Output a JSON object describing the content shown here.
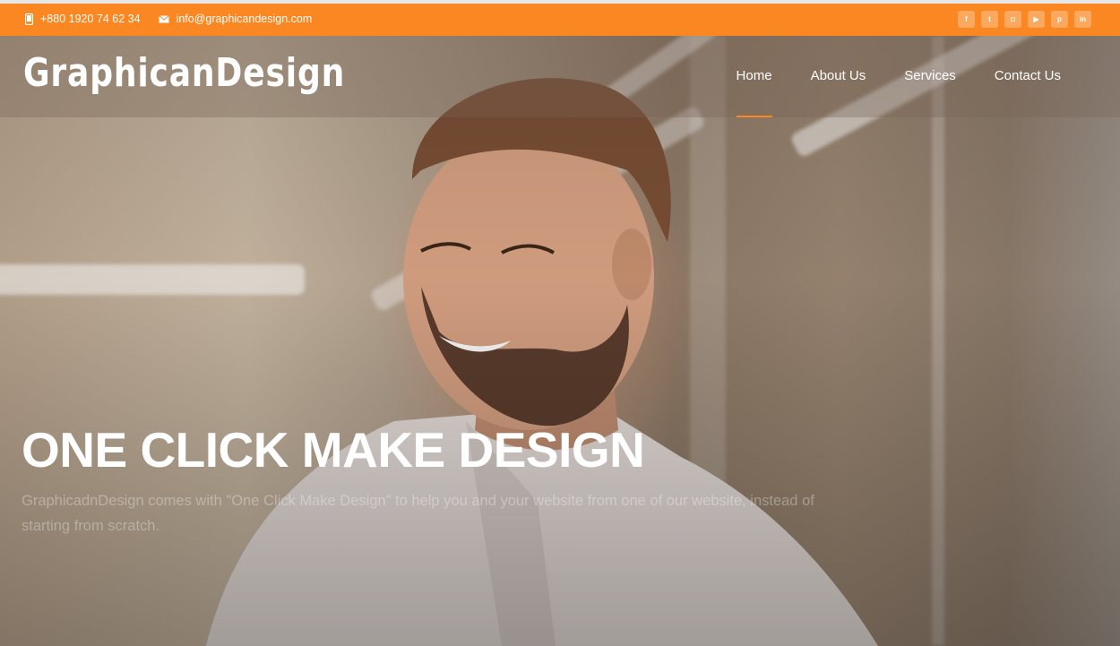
{
  "topbar": {
    "phone": "+880 1920 74 62 34",
    "email": "info@graphicandesign.com",
    "accent_color": "#fb8722",
    "social": [
      {
        "name": "facebook-icon",
        "glyph": "f"
      },
      {
        "name": "twitter-icon",
        "glyph": "t"
      },
      {
        "name": "instagram-icon",
        "glyph": "◘"
      },
      {
        "name": "youtube-icon",
        "glyph": "▶"
      },
      {
        "name": "pinterest-icon",
        "glyph": "p"
      },
      {
        "name": "linkedin-icon",
        "glyph": "in"
      }
    ]
  },
  "header": {
    "logo": "GraphicanDesign",
    "menu": [
      "Home",
      "About Us",
      "Services",
      "Contact Us"
    ]
  },
  "hero": {
    "title": "ONE CLICK MAKE DESIGN",
    "description": "GraphicadnDesign comes with \"One Click Make Design\" to help you and your website from one of our website, instead of starting from scratch."
  }
}
